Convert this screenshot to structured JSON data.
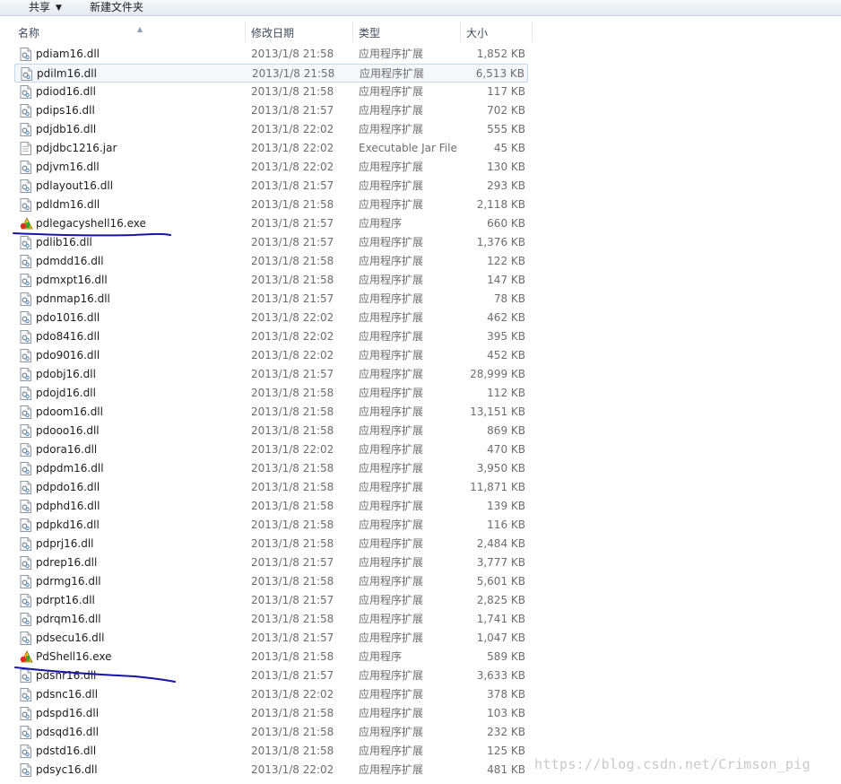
{
  "toolbar": {
    "share_label": "共享",
    "new_folder_label": "新建文件夹"
  },
  "columns": {
    "name": "名称",
    "date": "修改日期",
    "type": "类型",
    "size": "大小"
  },
  "files": [
    {
      "name": "pdiam16.dll",
      "date": "2013/1/8 21:58",
      "type": "应用程序扩展",
      "size": "1,852 KB",
      "icon": "dll-file-icon"
    },
    {
      "name": "pdilm16.dll",
      "date": "2013/1/8 21:58",
      "type": "应用程序扩展",
      "size": "6,513 KB",
      "icon": "dll-file-icon",
      "hovered": true
    },
    {
      "name": "pdiod16.dll",
      "date": "2013/1/8 21:58",
      "type": "应用程序扩展",
      "size": "117 KB",
      "icon": "dll-file-icon"
    },
    {
      "name": "pdips16.dll",
      "date": "2013/1/8 21:57",
      "type": "应用程序扩展",
      "size": "702 KB",
      "icon": "dll-file-icon"
    },
    {
      "name": "pdjdb16.dll",
      "date": "2013/1/8 22:02",
      "type": "应用程序扩展",
      "size": "555 KB",
      "icon": "dll-file-icon"
    },
    {
      "name": "pdjdbc1216.jar",
      "date": "2013/1/8 22:02",
      "type": "Executable Jar File",
      "size": "45 KB",
      "icon": "jar-file-icon"
    },
    {
      "name": "pdjvm16.dll",
      "date": "2013/1/8 22:02",
      "type": "应用程序扩展",
      "size": "130 KB",
      "icon": "dll-file-icon"
    },
    {
      "name": "pdlayout16.dll",
      "date": "2013/1/8 21:57",
      "type": "应用程序扩展",
      "size": "293 KB",
      "icon": "dll-file-icon"
    },
    {
      "name": "pdldm16.dll",
      "date": "2013/1/8 21:58",
      "type": "应用程序扩展",
      "size": "2,118 KB",
      "icon": "dll-file-icon"
    },
    {
      "name": "pdlegacyshell16.exe",
      "date": "2013/1/8 21:57",
      "type": "应用程序",
      "size": "660 KB",
      "icon": "exe-app-icon"
    },
    {
      "name": "pdlib16.dll",
      "date": "2013/1/8 21:57",
      "type": "应用程序扩展",
      "size": "1,376 KB",
      "icon": "dll-file-icon"
    },
    {
      "name": "pdmdd16.dll",
      "date": "2013/1/8 21:58",
      "type": "应用程序扩展",
      "size": "122 KB",
      "icon": "dll-file-icon"
    },
    {
      "name": "pdmxpt16.dll",
      "date": "2013/1/8 21:58",
      "type": "应用程序扩展",
      "size": "147 KB",
      "icon": "dll-file-icon"
    },
    {
      "name": "pdnmap16.dll",
      "date": "2013/1/8 21:57",
      "type": "应用程序扩展",
      "size": "78 KB",
      "icon": "dll-file-icon"
    },
    {
      "name": "pdo1016.dll",
      "date": "2013/1/8 22:02",
      "type": "应用程序扩展",
      "size": "462 KB",
      "icon": "dll-file-icon"
    },
    {
      "name": "pdo8416.dll",
      "date": "2013/1/8 22:02",
      "type": "应用程序扩展",
      "size": "395 KB",
      "icon": "dll-file-icon"
    },
    {
      "name": "pdo9016.dll",
      "date": "2013/1/8 22:02",
      "type": "应用程序扩展",
      "size": "452 KB",
      "icon": "dll-file-icon"
    },
    {
      "name": "pdobj16.dll",
      "date": "2013/1/8 21:57",
      "type": "应用程序扩展",
      "size": "28,999 KB",
      "icon": "dll-file-icon"
    },
    {
      "name": "pdojd16.dll",
      "date": "2013/1/8 21:58",
      "type": "应用程序扩展",
      "size": "112 KB",
      "icon": "dll-file-icon"
    },
    {
      "name": "pdoom16.dll",
      "date": "2013/1/8 21:58",
      "type": "应用程序扩展",
      "size": "13,151 KB",
      "icon": "dll-file-icon"
    },
    {
      "name": "pdooo16.dll",
      "date": "2013/1/8 21:58",
      "type": "应用程序扩展",
      "size": "869 KB",
      "icon": "dll-file-icon"
    },
    {
      "name": "pdora16.dll",
      "date": "2013/1/8 22:02",
      "type": "应用程序扩展",
      "size": "470 KB",
      "icon": "dll-file-icon"
    },
    {
      "name": "pdpdm16.dll",
      "date": "2013/1/8 21:58",
      "type": "应用程序扩展",
      "size": "3,950 KB",
      "icon": "dll-file-icon"
    },
    {
      "name": "pdpdo16.dll",
      "date": "2013/1/8 21:58",
      "type": "应用程序扩展",
      "size": "11,871 KB",
      "icon": "dll-file-icon"
    },
    {
      "name": "pdphd16.dll",
      "date": "2013/1/8 21:58",
      "type": "应用程序扩展",
      "size": "139 KB",
      "icon": "dll-file-icon"
    },
    {
      "name": "pdpkd16.dll",
      "date": "2013/1/8 21:58",
      "type": "应用程序扩展",
      "size": "116 KB",
      "icon": "dll-file-icon"
    },
    {
      "name": "pdprj16.dll",
      "date": "2013/1/8 21:58",
      "type": "应用程序扩展",
      "size": "2,484 KB",
      "icon": "dll-file-icon"
    },
    {
      "name": "pdrep16.dll",
      "date": "2013/1/8 21:57",
      "type": "应用程序扩展",
      "size": "3,777 KB",
      "icon": "dll-file-icon"
    },
    {
      "name": "pdrmg16.dll",
      "date": "2013/1/8 21:58",
      "type": "应用程序扩展",
      "size": "5,601 KB",
      "icon": "dll-file-icon"
    },
    {
      "name": "pdrpt16.dll",
      "date": "2013/1/8 21:57",
      "type": "应用程序扩展",
      "size": "2,825 KB",
      "icon": "dll-file-icon"
    },
    {
      "name": "pdrqm16.dll",
      "date": "2013/1/8 21:58",
      "type": "应用程序扩展",
      "size": "1,741 KB",
      "icon": "dll-file-icon"
    },
    {
      "name": "pdsecu16.dll",
      "date": "2013/1/8 21:57",
      "type": "应用程序扩展",
      "size": "1,047 KB",
      "icon": "dll-file-icon"
    },
    {
      "name": "PdShell16.exe",
      "date": "2013/1/8 21:58",
      "type": "应用程序",
      "size": "589 KB",
      "icon": "exe-app-icon"
    },
    {
      "name": "pdshr16.dll",
      "date": "2013/1/8 21:57",
      "type": "应用程序扩展",
      "size": "3,633 KB",
      "icon": "dll-file-icon"
    },
    {
      "name": "pdsnc16.dll",
      "date": "2013/1/8 22:02",
      "type": "应用程序扩展",
      "size": "378 KB",
      "icon": "dll-file-icon"
    },
    {
      "name": "pdspd16.dll",
      "date": "2013/1/8 21:58",
      "type": "应用程序扩展",
      "size": "103 KB",
      "icon": "dll-file-icon"
    },
    {
      "name": "pdsqd16.dll",
      "date": "2013/1/8 21:58",
      "type": "应用程序扩展",
      "size": "232 KB",
      "icon": "dll-file-icon"
    },
    {
      "name": "pdstd16.dll",
      "date": "2013/1/8 21:58",
      "type": "应用程序扩展",
      "size": "125 KB",
      "icon": "dll-file-icon"
    },
    {
      "name": "pdsyc16.dll",
      "date": "2013/1/8 22:02",
      "type": "应用程序扩展",
      "size": "481 KB",
      "icon": "dll-file-icon"
    }
  ],
  "annotation_color": "#1515a8",
  "watermark": "https://blog.csdn.net/Crimson_pig"
}
